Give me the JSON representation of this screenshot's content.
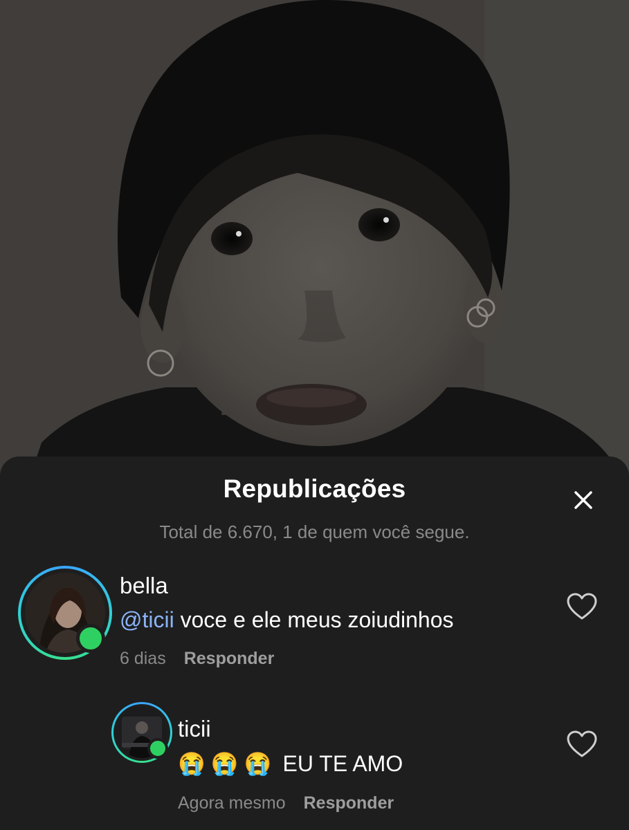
{
  "sheet": {
    "title": "Republicações",
    "subtitle": "Total de 6.670, 1 de quem você segue."
  },
  "comments": [
    {
      "username": "bella",
      "mention": "@ticii",
      "text": " voce e ele meus zoiudinhos",
      "time": "6 dias",
      "reply_label": "Responder",
      "like_icon": "heart-outline-icon"
    },
    {
      "username": "ticii",
      "emojis": [
        "😭",
        "😭",
        "😭"
      ],
      "text": "EU TE AMO",
      "time": "Agora mesmo",
      "reply_label": "Responder",
      "like_icon": "heart-outline-icon"
    }
  ],
  "icons": {
    "close": "close-icon",
    "online": "online-status-dot"
  },
  "colors": {
    "sheet_background": "#1e1e1e",
    "mention": "#8ab4f8",
    "online": "#2fd062",
    "ring_start": "#3ba3ff",
    "ring_end": "#38e08a"
  }
}
